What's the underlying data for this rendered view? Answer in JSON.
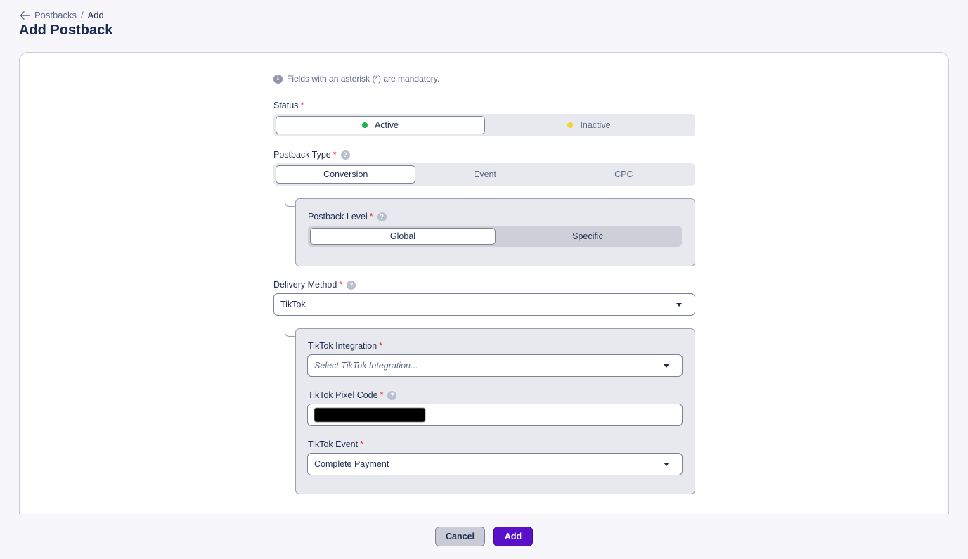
{
  "breadcrumb": {
    "parent": "Postbacks",
    "separator": "/",
    "current": "Add"
  },
  "page": {
    "title": "Add Postback"
  },
  "form": {
    "info_text": "Fields with an asterisk (*) are mandatory.",
    "required_marker": "*",
    "status": {
      "label": "Status",
      "options": [
        {
          "label": "Active",
          "color": "#1fb24a",
          "selected": true
        },
        {
          "label": "Inactive",
          "color": "#f2d43a",
          "selected": false
        }
      ]
    },
    "postback_type": {
      "label": "Postback Type",
      "options": [
        {
          "label": "Conversion",
          "selected": true
        },
        {
          "label": "Event",
          "selected": false
        },
        {
          "label": "CPC",
          "selected": false
        }
      ]
    },
    "postback_level": {
      "label": "Postback Level",
      "options": [
        {
          "label": "Global",
          "selected": true
        },
        {
          "label": "Specific",
          "selected": false
        }
      ]
    },
    "delivery_method": {
      "label": "Delivery Method",
      "value": "TikTok"
    },
    "tiktok_integration": {
      "label": "TikTok Integration",
      "placeholder": "Select TikTok Integration..."
    },
    "tiktok_pixel_code": {
      "label": "TikTok Pixel Code"
    },
    "tiktok_event": {
      "label": "TikTok Event",
      "value": "Complete Payment"
    }
  },
  "actions": {
    "cancel_label": "Cancel",
    "add_label": "Add"
  },
  "colors": {
    "accent": "#5a10c8",
    "required": "#e2263d",
    "title": "#1a2a52"
  }
}
